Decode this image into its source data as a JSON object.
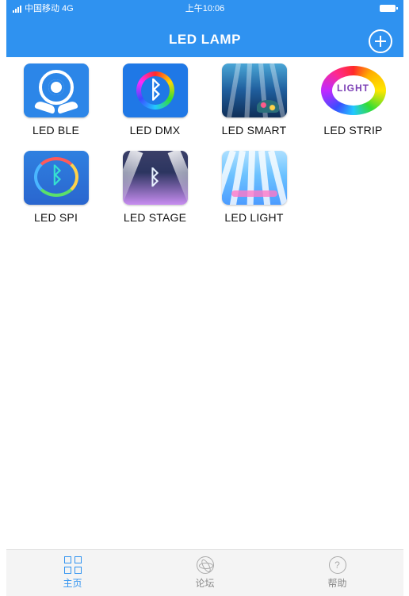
{
  "status_bar": {
    "carrier": "中国移动 4G",
    "time": "上午10:06"
  },
  "header": {
    "title": "LED LAMP",
    "add_icon": "plus-circle-icon"
  },
  "apps": [
    {
      "label": "LED BLE",
      "icon": "led-ble-icon"
    },
    {
      "label": "LED DMX",
      "icon": "led-dmx-icon"
    },
    {
      "label": "LED SMART",
      "icon": "led-smart-icon"
    },
    {
      "label": "LED STRIP",
      "icon": "led-strip-icon",
      "icon_text": "LIGHT"
    },
    {
      "label": "LED SPI",
      "icon": "led-spi-icon"
    },
    {
      "label": "LED STAGE",
      "icon": "led-stage-icon"
    },
    {
      "label": "LED LIGHT",
      "icon": "led-light-icon"
    }
  ],
  "tabs": [
    {
      "label": "主页",
      "icon": "grid-icon",
      "active": true
    },
    {
      "label": "论坛",
      "icon": "atom-icon",
      "active": false
    },
    {
      "label": "帮助",
      "icon": "help-icon",
      "active": false
    }
  ],
  "colors": {
    "accent": "#2f92f0",
    "background": "#ffffff",
    "tabbar": "#f4f4f4"
  }
}
